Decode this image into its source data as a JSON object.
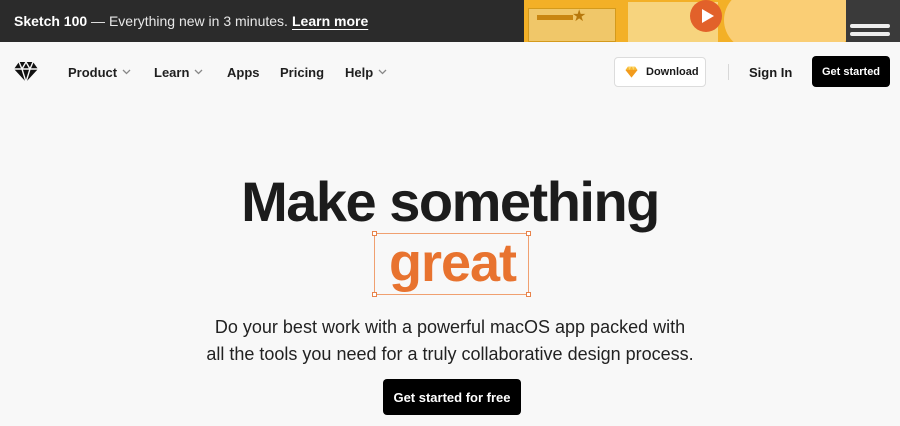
{
  "banner": {
    "strong": "Sketch 100",
    "rest": " — Everything new in 3 minutes.",
    "link": "Learn more"
  },
  "nav": {
    "items": [
      {
        "label": "Product",
        "has_menu": true
      },
      {
        "label": "Learn",
        "has_menu": true
      },
      {
        "label": "Apps",
        "has_menu": false
      },
      {
        "label": "Pricing",
        "has_menu": false
      },
      {
        "label": "Help",
        "has_menu": true
      }
    ],
    "download": "Download",
    "sign_in": "Sign In",
    "get_started": "Get started"
  },
  "hero": {
    "title": "Make something",
    "highlight": "great",
    "subtitle_line1": "Do your best work with a powerful macOS app packed with",
    "subtitle_line2": "all the tools you need for a truly collaborative design process.",
    "cta": "Get started for free"
  },
  "colors": {
    "accent": "#e8732f",
    "banner_bg": "#2b2b2b",
    "button_bg": "#000000"
  },
  "icons": [
    "sketch-logo-icon",
    "chevron-down-icon",
    "sketch-gem-icon",
    "play-icon"
  ]
}
